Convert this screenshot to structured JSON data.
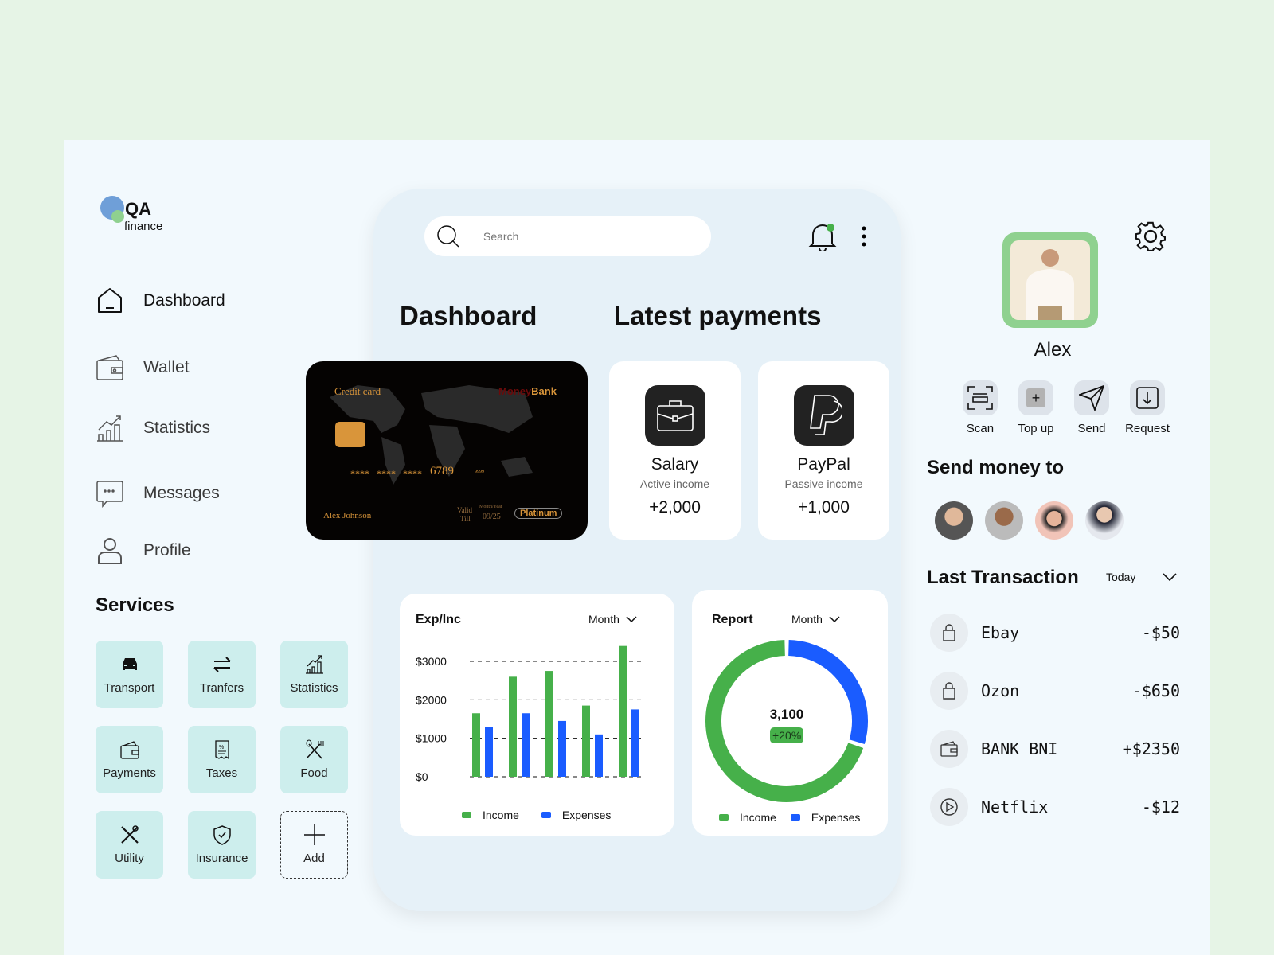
{
  "brand": {
    "name": "QA",
    "sub": "finance"
  },
  "sidebar": {
    "items": [
      {
        "label": "Dashboard",
        "icon": "home-icon"
      },
      {
        "label": "Wallet",
        "icon": "wallet-icon"
      },
      {
        "label": "Statistics",
        "icon": "chart-icon"
      },
      {
        "label": "Messages",
        "icon": "chat-icon"
      },
      {
        "label": "Profile",
        "icon": "user-icon"
      }
    ]
  },
  "services": {
    "title": "Services",
    "items": [
      {
        "label": "Transport",
        "icon": "car-icon"
      },
      {
        "label": "Tranfers",
        "icon": "transfer-icon"
      },
      {
        "label": "Statistics",
        "icon": "chart-icon"
      },
      {
        "label": "Payments",
        "icon": "wallet-icon"
      },
      {
        "label": "Taxes",
        "icon": "receipt-icon"
      },
      {
        "label": "Food",
        "icon": "cutlery-icon"
      },
      {
        "label": "Utility",
        "icon": "tools-icon"
      },
      {
        "label": "Insurance",
        "icon": "shield-icon"
      },
      {
        "label": "Add",
        "icon": "plus-icon"
      }
    ]
  },
  "search": {
    "placeholder": "Search"
  },
  "headings": {
    "dashboard": "Dashboard",
    "latest": "Latest payments"
  },
  "card": {
    "type": "Credit card",
    "bank_a": "Money",
    "bank_b": "Bank",
    "masked": "**** **** ****",
    "last4": "6789",
    "small": "9999",
    "holder": "Alex Johnson",
    "valid": "Valid",
    "till": "Till",
    "my": "Month/Year",
    "expiry": "09/25",
    "tier": "Platinum"
  },
  "payments": [
    {
      "title": "Salary",
      "sub": "Active income",
      "value": "+2,000",
      "icon": "briefcase-icon"
    },
    {
      "title": "PayPal",
      "sub": "Passive income",
      "value": "+1,000",
      "icon": "paypal-icon"
    }
  ],
  "chart_data": [
    {
      "type": "bar",
      "title": "Exp/Inc",
      "period": "Month",
      "yticks": [
        "$3000",
        "$2000",
        "$1000",
        "$0"
      ],
      "ylim": [
        0,
        3000
      ],
      "grid": "dashed horizontal",
      "legend": "bottom",
      "series": [
        {
          "name": "Income",
          "color": "#46b04a",
          "values": [
            1650,
            2600,
            2750,
            1850,
            3400
          ]
        },
        {
          "name": "Expenses",
          "color": "#1a5cff",
          "values": [
            1300,
            1650,
            1450,
            1100,
            1750
          ]
        }
      ]
    },
    {
      "type": "pie",
      "title": "Report",
      "period": "Month",
      "center_value": "3,100",
      "badge": "+20%",
      "legend": "bottom",
      "series": [
        {
          "name": "Income",
          "color": "#46b04a",
          "value": 70
        },
        {
          "name": "Expenses",
          "color": "#1a5cff",
          "value": 30
        }
      ]
    }
  ],
  "profile": {
    "name": "Alex",
    "actions": [
      {
        "label": "Scan"
      },
      {
        "label": "Top up"
      },
      {
        "label": "Send"
      },
      {
        "label": "Request"
      }
    ]
  },
  "send": {
    "title": "Send money to"
  },
  "transactions": {
    "title": "Last Transaction",
    "filter": "Today",
    "items": [
      {
        "name": "Ebay",
        "amount": "-$50",
        "icon": "bag-icon"
      },
      {
        "name": "Ozon",
        "amount": "-$650",
        "icon": "bag-icon"
      },
      {
        "name": "BANK BNI",
        "amount": "+$2350",
        "icon": "wallet-icon"
      },
      {
        "name": "Netflix",
        "amount": "-$12",
        "icon": "play-icon"
      }
    ]
  }
}
